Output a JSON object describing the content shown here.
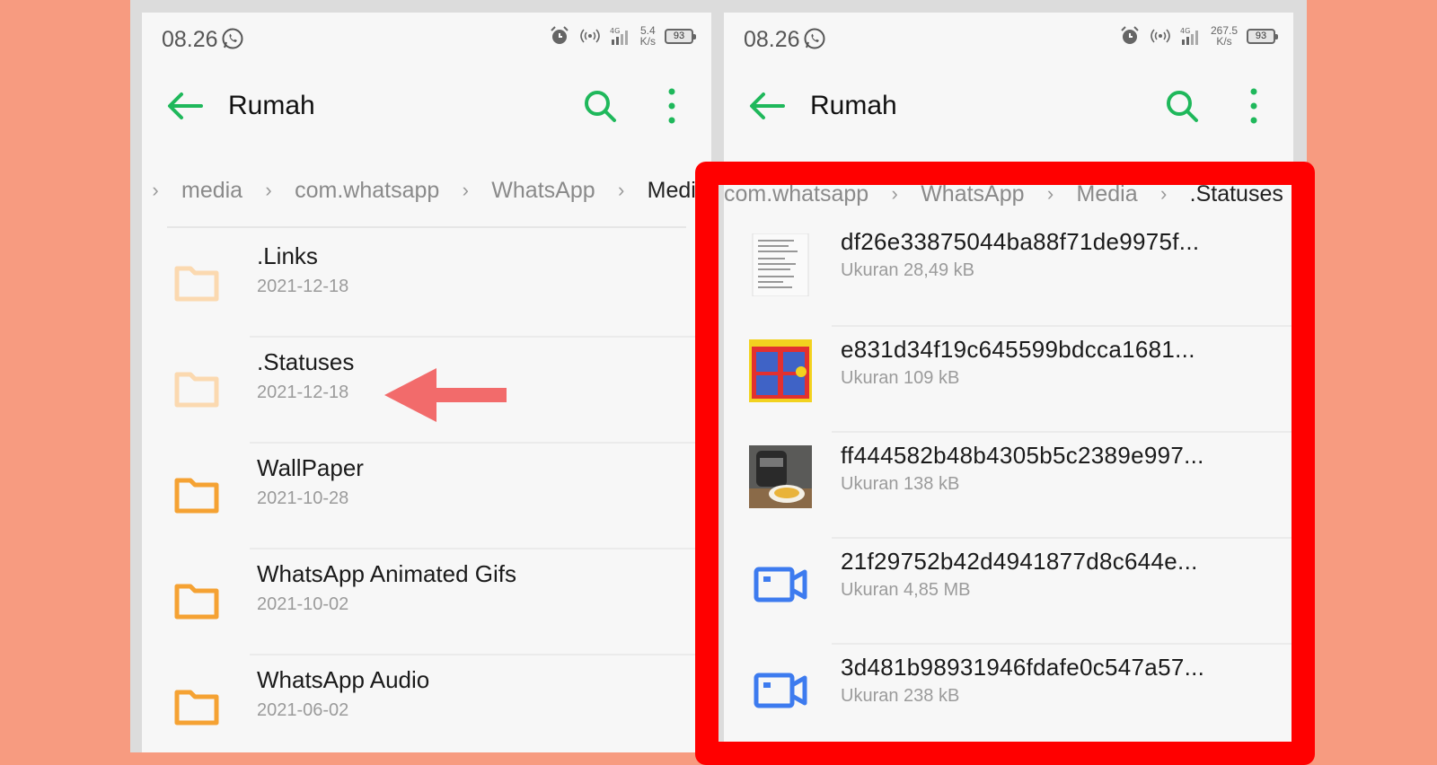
{
  "colors": {
    "accent": "#1fb85b",
    "highlight": "#ff0000",
    "folder_active": "#f5a233",
    "folder_hidden": "#fbd9b0",
    "video": "#3d7bef"
  },
  "left": {
    "status_bar": {
      "time": "08.26",
      "speed_value": "5.4",
      "speed_unit": "K/s",
      "battery": "93"
    },
    "app_bar": {
      "title": "Rumah"
    },
    "breadcrumb": [
      "media",
      "com.whatsapp",
      "WhatsApp",
      "Media"
    ],
    "folders": [
      {
        "name": ".Links",
        "date": "2021-12-18",
        "icon": "folder-icon",
        "hidden": true
      },
      {
        "name": ".Statuses",
        "date": "2021-12-18",
        "icon": "folder-icon",
        "hidden": true
      },
      {
        "name": "WallPaper",
        "date": "2021-10-28",
        "icon": "folder-icon",
        "hidden": false
      },
      {
        "name": "WhatsApp Animated Gifs",
        "date": "2021-10-02",
        "icon": "folder-icon",
        "hidden": false
      },
      {
        "name": "WhatsApp Audio",
        "date": "2021-06-02",
        "icon": "folder-icon",
        "hidden": false
      }
    ]
  },
  "right": {
    "status_bar": {
      "time": "08.26",
      "speed_value": "267.5",
      "speed_unit": "K/s",
      "battery": "93"
    },
    "app_bar": {
      "title": "Rumah"
    },
    "breadcrumb": [
      "com.whatsapp",
      "WhatsApp",
      "Media",
      ".Statuses"
    ],
    "files": [
      {
        "name": "df26e33875044ba88f71de9975f...",
        "size": "Ukuran 28,49 kB",
        "icon": "document-thumbnail"
      },
      {
        "name": "e831d34f19c645599bdcca1681...",
        "size": "Ukuran 109 kB",
        "icon": "image-thumbnail"
      },
      {
        "name": "ff444582b48b4305b5c2389e997...",
        "size": "Ukuran 138 kB",
        "icon": "photo-thumbnail"
      },
      {
        "name": "21f29752b42d4941877d8c644e...",
        "size": "Ukuran 4,85 MB",
        "icon": "video-icon"
      },
      {
        "name": "3d481b98931946fdafe0c547a57...",
        "size": "Ukuran 238 kB",
        "icon": "video-icon"
      }
    ]
  }
}
